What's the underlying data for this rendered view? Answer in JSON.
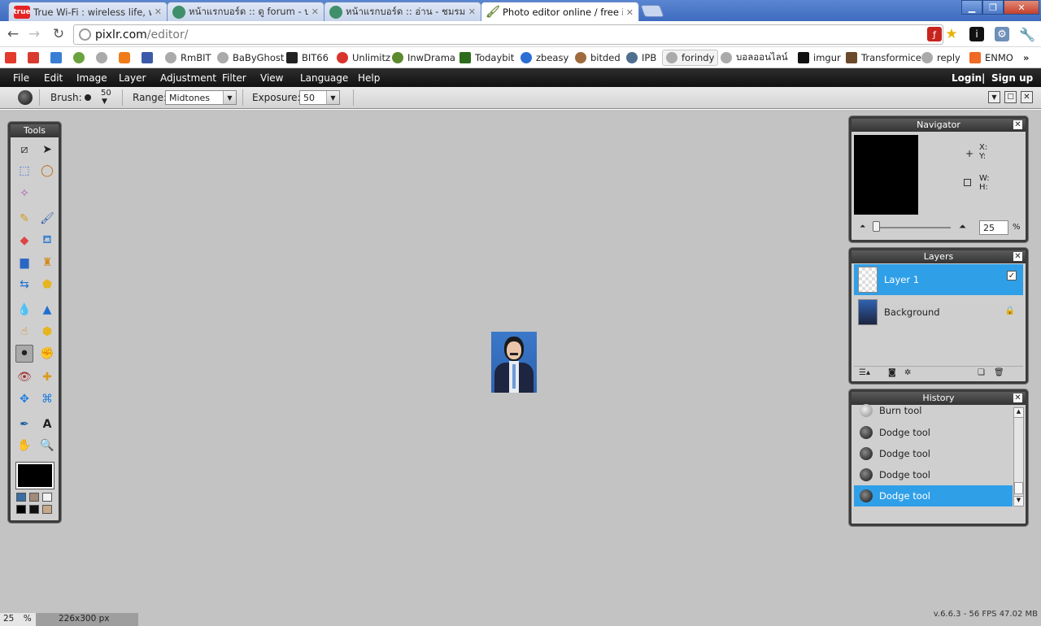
{
  "browser": {
    "tabs": [
      {
        "favicon_text": "true",
        "favicon_color": "#e52424",
        "title": "True Wi-Fi : wireless life, wireless"
      },
      {
        "favicon_text": "",
        "favicon_color": "#3f8f6a",
        "title": "หน้าแรกบอร์ด :: ดู forum - บอร์ด"
      },
      {
        "favicon_text": "",
        "favicon_color": "#3f8f6a",
        "title": "หน้าแรกบอร์ด :: อ่าน - ชมรมคน"
      },
      {
        "favicon_text": "",
        "favicon_color": "#6a8a3a",
        "title": "Photo editor online / free image"
      }
    ],
    "url_host": "pixlr.com",
    "url_path": "/editor/",
    "bookmarks": [
      {
        "label": "",
        "color": "#e23b2e"
      },
      {
        "label": "",
        "color": "#d93a2e"
      },
      {
        "label": "",
        "color": "#3a7ed4"
      },
      {
        "label": "",
        "color": "#6aa33d"
      },
      {
        "label": "",
        "color": "#aaaaaa"
      },
      {
        "label": "",
        "color": "#f07b19"
      },
      {
        "label": "",
        "color": "#3c5aa8"
      },
      {
        "label": "RmBIT",
        "color": "#aaaaaa"
      },
      {
        "label": "BaByGhost",
        "color": "#aaaaaa"
      },
      {
        "label": "BIT66",
        "color": "#222222"
      },
      {
        "label": "Unlimitz",
        "color": "#d9342b"
      },
      {
        "label": "InwDrama",
        "color": "#5c8a2f"
      },
      {
        "label": "Todaybit",
        "color": "#2d6b1d"
      },
      {
        "label": "zbeasy",
        "color": "#2b6ed3"
      },
      {
        "label": "bitded",
        "color": "#a06a3c"
      },
      {
        "label": "IPB",
        "color": "#4f6f8f"
      },
      {
        "label": "forindy",
        "color": "#aaaaaa"
      },
      {
        "label": "บอลออนไลน์",
        "color": "#aaaaaa"
      },
      {
        "label": "imgur",
        "color": "#111111"
      },
      {
        "label": "Transformice",
        "color": "#6b4a2a"
      },
      {
        "label": "reply",
        "color": "#aaaaaa"
      },
      {
        "label": "ENMO",
        "color": "#f06a25"
      }
    ],
    "more_bookmarks": "»"
  },
  "menu": {
    "items": [
      "File",
      "Edit",
      "Image",
      "Layer",
      "Adjustment",
      "Filter",
      "View",
      "Language",
      "Help"
    ],
    "login": "Login",
    "divider": "|",
    "signup": "Sign up"
  },
  "options": {
    "brush_label": "Brush:",
    "brush_size": "50",
    "range_label": "Range:",
    "range_value": "Midtones",
    "exposure_label": "Exposure:",
    "exposure_value": "50"
  },
  "tools_panel": {
    "title": "Tools"
  },
  "navigator": {
    "title": "Navigator",
    "x_label": "X:",
    "y_label": "Y:",
    "w_label": "W:",
    "h_label": "H:",
    "zoom": "25",
    "zoom_unit": "%"
  },
  "layers": {
    "title": "Layers",
    "items": [
      {
        "name": "Layer 1",
        "active": true
      },
      {
        "name": "Background",
        "active": false
      }
    ]
  },
  "history": {
    "title": "History",
    "items": [
      "Burn tool",
      "Dodge tool",
      "Dodge tool",
      "Dodge tool",
      "Dodge tool"
    ]
  },
  "status": {
    "zoom": "25",
    "zoom_unit": "%",
    "size": "226x300 px",
    "version": "v.6.6.3 - 56 FPS 47.02 MB"
  },
  "colors": {
    "accent_blue": "#2f9fe8",
    "swatches": [
      "#3a6ea5",
      "#a08a7a",
      "#f2f2f2",
      "#000000",
      "#111111",
      "#c7a88a"
    ]
  }
}
